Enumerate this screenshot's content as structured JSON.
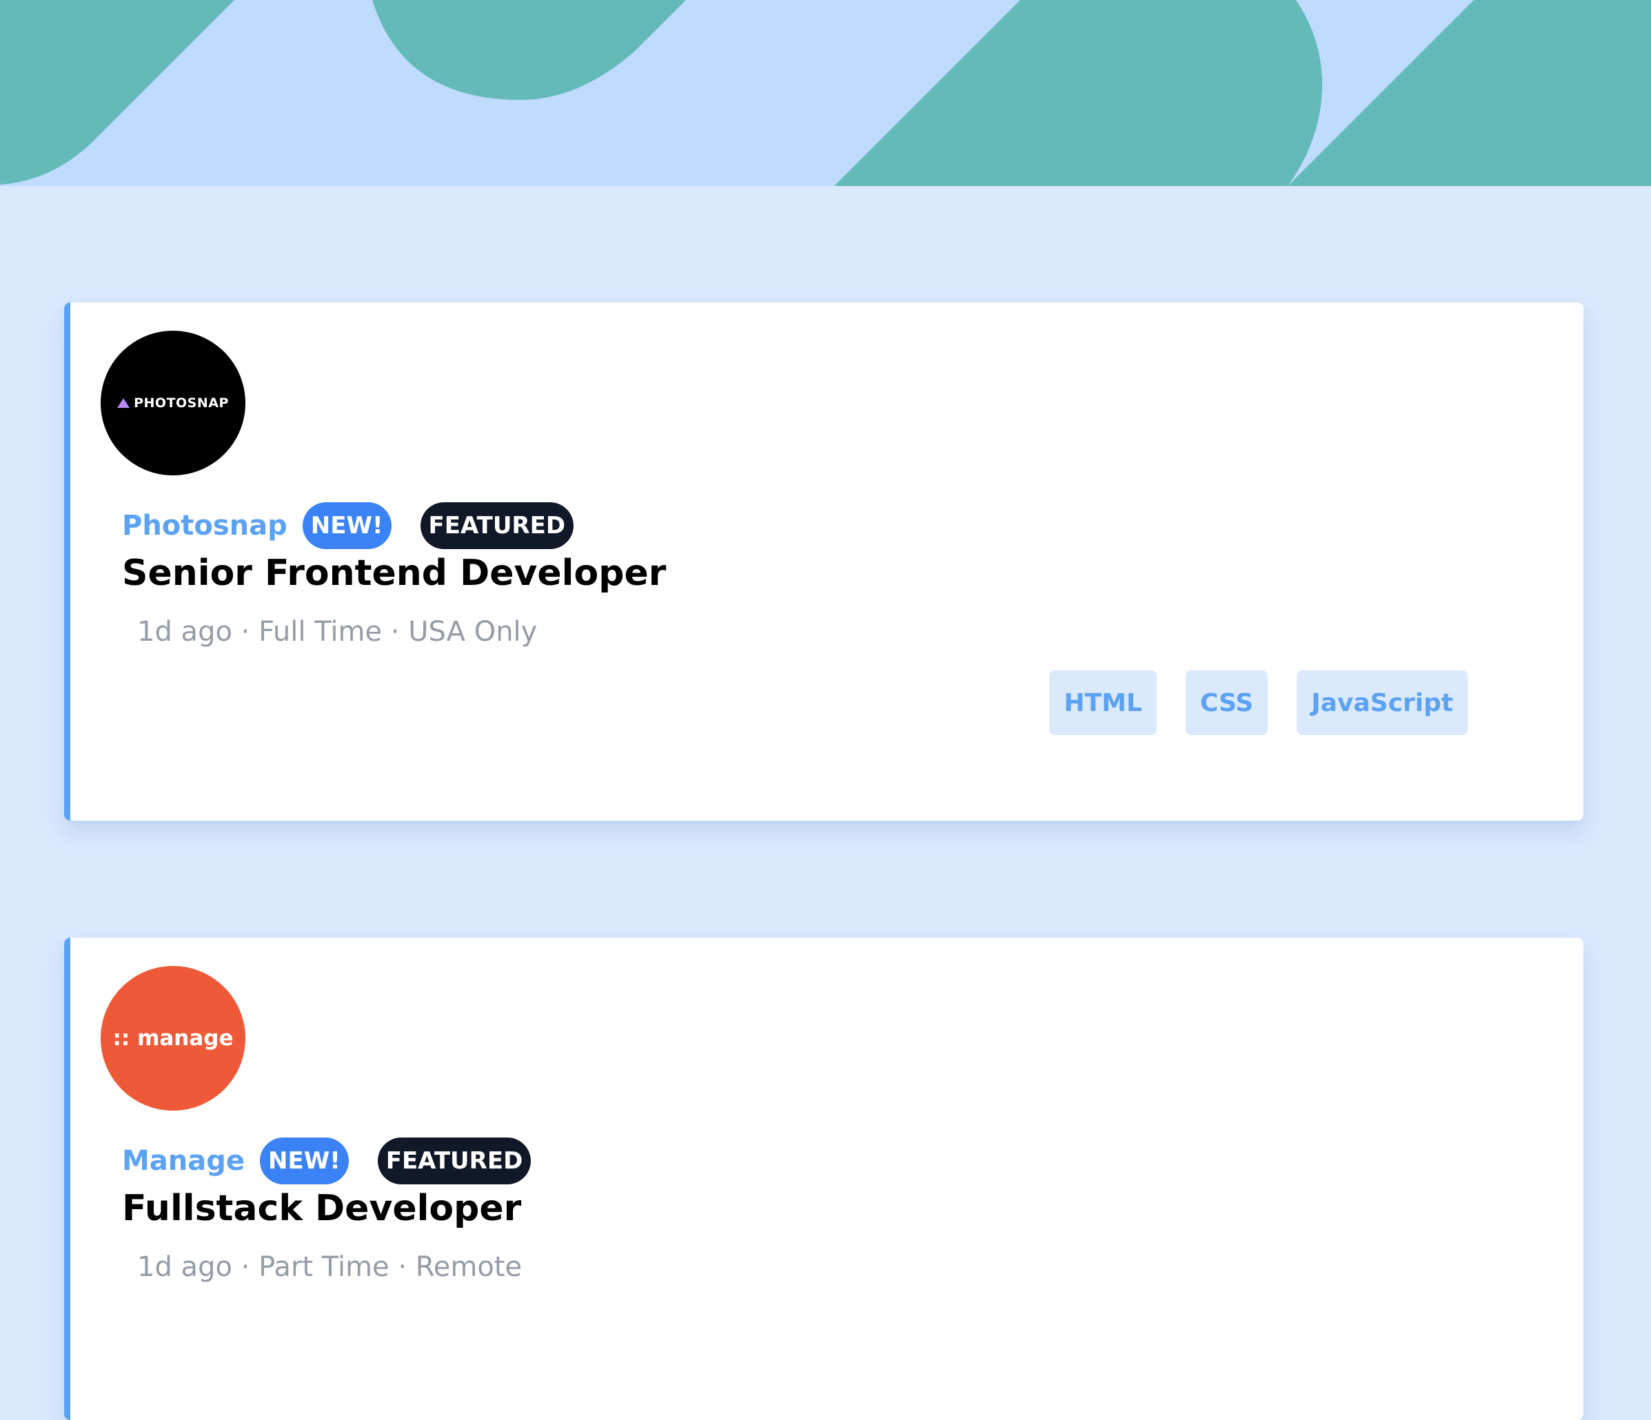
{
  "header": {
    "colors": {
      "light": "#bfdbfe",
      "teal": "#64bab9"
    }
  },
  "jobs": [
    {
      "logo_text": "PHOTOSNAP",
      "company": "Photosnap",
      "new_label": "NEW!",
      "featured_label": "FEATURED",
      "title": "Senior Frontend Developer",
      "meta": "1d ago · Full Time · USA Only",
      "tags": [
        "HTML",
        "CSS",
        "JavaScript"
      ]
    },
    {
      "logo_text": ":: manage",
      "company": "Manage",
      "new_label": "NEW!",
      "featured_label": "FEATURED",
      "title": "Fullstack Developer",
      "meta": "1d ago · Part Time · Remote",
      "tags": []
    }
  ],
  "colors": {
    "accent": "#5ba2f3",
    "new_badge": "#3b82f6",
    "featured_badge": "#111827",
    "background": "#dbe9fd"
  }
}
